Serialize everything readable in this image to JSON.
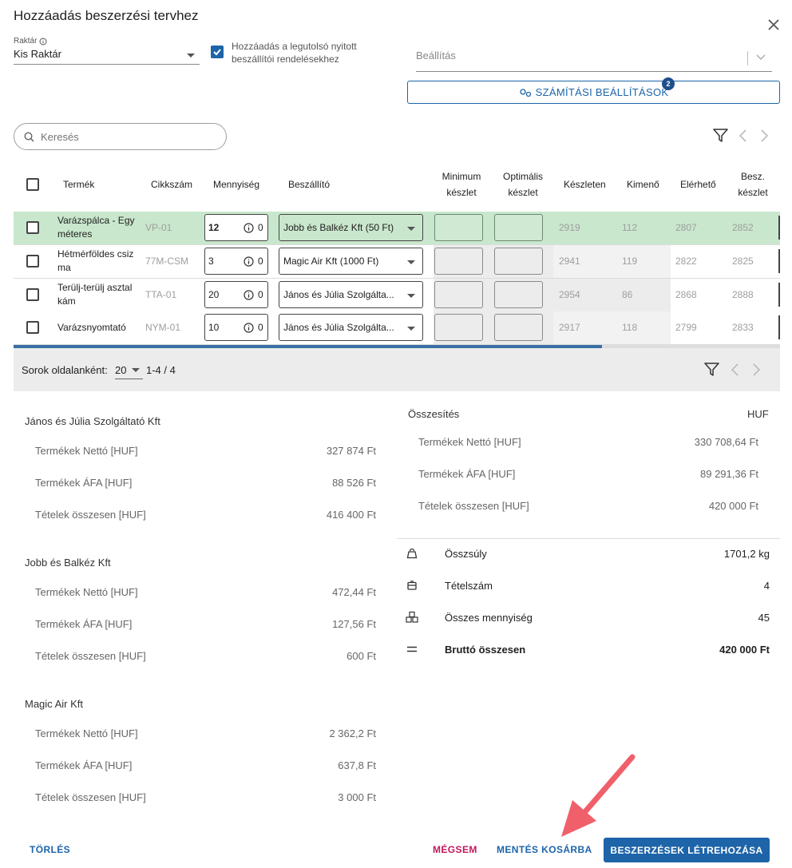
{
  "dialog": {
    "title": "Hozzáadás beszerzési tervhez",
    "close_icon": "close-icon"
  },
  "warehouse": {
    "label": "Raktár",
    "value": "Kis Raktár"
  },
  "add_to_open_orders": {
    "checked": true,
    "label_line1": "Hozzáadás a legutolsó nyitott",
    "label_line2": "beszállítói rendelésekhez"
  },
  "setting": {
    "placeholder": "Beállítás"
  },
  "calc_settings": {
    "label": "SZÁMÍTÁSI BEÁLLÍTÁSOK",
    "badge": "2"
  },
  "search": {
    "placeholder": "Keresés"
  },
  "columns": {
    "product": "Termék",
    "sku": "Cikkszám",
    "quantity": "Mennyiség",
    "supplier": "Beszállító",
    "min_stock_1": "Minimum",
    "min_stock_2": "készlet",
    "opt_stock_1": "Optimális",
    "opt_stock_2": "készlet",
    "in_stock": "Készleten",
    "outgoing": "Kimenő",
    "available": "Elérhető",
    "incoming_1": "Besz.",
    "incoming_2": "készlet"
  },
  "rows": [
    {
      "name_1": "Varázspálca - Egy",
      "name_2": "méteres",
      "sku": "VP-01",
      "qty": "12",
      "qty_info": "0",
      "supplier": "Jobb és Balkéz Kft (50 Ft)",
      "in_stock": "2919",
      "outgoing": "112",
      "available": "2807",
      "incoming": "2852"
    },
    {
      "name_1": "Hétmérföldes csiz",
      "name_2": "ma",
      "sku": "77M-CSM",
      "qty": "3",
      "qty_info": "0",
      "supplier": "Magic Air Kft (1000 Ft)",
      "in_stock": "2941",
      "outgoing": "119",
      "available": "2822",
      "incoming": "2825"
    },
    {
      "name_1": "Terülj-terülj asztal",
      "name_2": "kám",
      "sku": "TTA-01",
      "qty": "20",
      "qty_info": "0",
      "supplier": "János és Júlia Szolgálta...",
      "in_stock": "2954",
      "outgoing": "86",
      "available": "2868",
      "incoming": "2888"
    },
    {
      "name_1": "Varázsnyomtató",
      "name_2": "",
      "sku": "NYM-01",
      "qty": "10",
      "qty_info": "0",
      "supplier": "János és Júlia Szolgálta...",
      "in_stock": "2917",
      "outgoing": "118",
      "available": "2799",
      "incoming": "2833"
    }
  ],
  "pagination": {
    "rows_per_page_label": "Sorok oldalanként:",
    "rows_per_page": "20",
    "range": "1-4 / 4"
  },
  "suppliers_summary": [
    {
      "name": "János és Júlia Szolgáltató Kft",
      "net_label": "Termékek Nettó [HUF]",
      "net": "327 874 Ft",
      "vat_label": "Termékek ÁFA [HUF]",
      "vat": "88 526 Ft",
      "total_label": "Tételek összesen [HUF]",
      "total": "416 400 Ft"
    },
    {
      "name": "Jobb és Balkéz Kft",
      "net_label": "Termékek Nettó [HUF]",
      "net": "472,44 Ft",
      "vat_label": "Termékek ÁFA [HUF]",
      "vat": "127,56 Ft",
      "total_label": "Tételek összesen [HUF]",
      "total": "600 Ft"
    },
    {
      "name": "Magic Air Kft",
      "net_label": "Termékek Nettó [HUF]",
      "net": "2 362,2 Ft",
      "vat_label": "Termékek ÁFA [HUF]",
      "vat": "637,8 Ft",
      "total_label": "Tételek összesen [HUF]",
      "total": "3 000 Ft"
    }
  ],
  "totals": {
    "title": "Összesítés",
    "currency": "HUF",
    "net_label": "Termékek Nettó [HUF]",
    "net": "330 708,64 Ft",
    "vat_label": "Termékek ÁFA [HUF]",
    "vat": "89 291,36 Ft",
    "items_label": "Tételek összesen [HUF]",
    "items": "420 000 Ft",
    "weight_label": "Összsúly",
    "weight": "1701,2 kg",
    "count_label": "Tételszám",
    "count": "4",
    "quantity_label": "Összes mennyiség",
    "quantity": "45",
    "gross_label": "Bruttó összesen",
    "gross": "420 000 Ft"
  },
  "footer": {
    "delete": "TÖRLÉS",
    "cancel": "MÉGSEM",
    "save_to_cart": "MENTÉS KOSÁRBA",
    "create": "BESZERZÉSEK LÉTREHOZÁSA"
  },
  "colors": {
    "primary": "#1d64a8",
    "selected_row": "#c9e7cc",
    "cancel": "#c2185b",
    "arrow": "#f0606a"
  }
}
